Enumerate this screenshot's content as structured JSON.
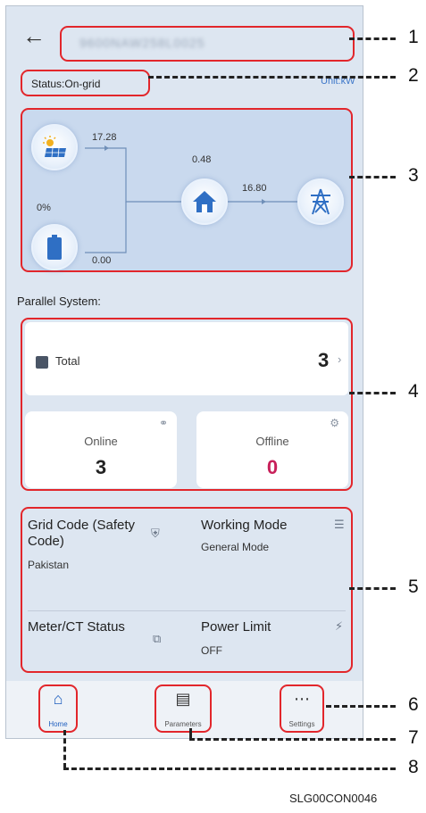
{
  "header": {
    "device_name": "9600NAW258L0025",
    "back_icon": "back-arrow-icon"
  },
  "status": {
    "label": "Status:On-grid",
    "unit": "Unit:kW"
  },
  "flow": {
    "pv_power": "17.28",
    "load_power": "0.48",
    "grid_power": "16.80",
    "battery_soc": "0%",
    "battery_power": "0.00"
  },
  "parallel": {
    "title": "Parallel System:",
    "total_label": "Total",
    "total_count": "3",
    "online_label": "Online",
    "online_count": "3",
    "offline_label": "Offline",
    "offline_count": "0",
    "offline_color": "#c8205a"
  },
  "info": {
    "grid_code_title": "Grid Code (Safety Code)",
    "grid_code_value": "Pakistan",
    "working_mode_title": "Working Mode",
    "working_mode_value": "General Mode",
    "meter_title": "Meter/CT Status",
    "power_limit_title": "Power Limit",
    "power_limit_value": "OFF"
  },
  "nav": {
    "home": "Home",
    "parameters": "Parameters",
    "settings": "Settings",
    "active_color": "#1f5fbf"
  },
  "callouts": [
    "1",
    "2",
    "3",
    "4",
    "5",
    "6",
    "7",
    "8"
  ],
  "figure_id": "SLG00CON0046"
}
